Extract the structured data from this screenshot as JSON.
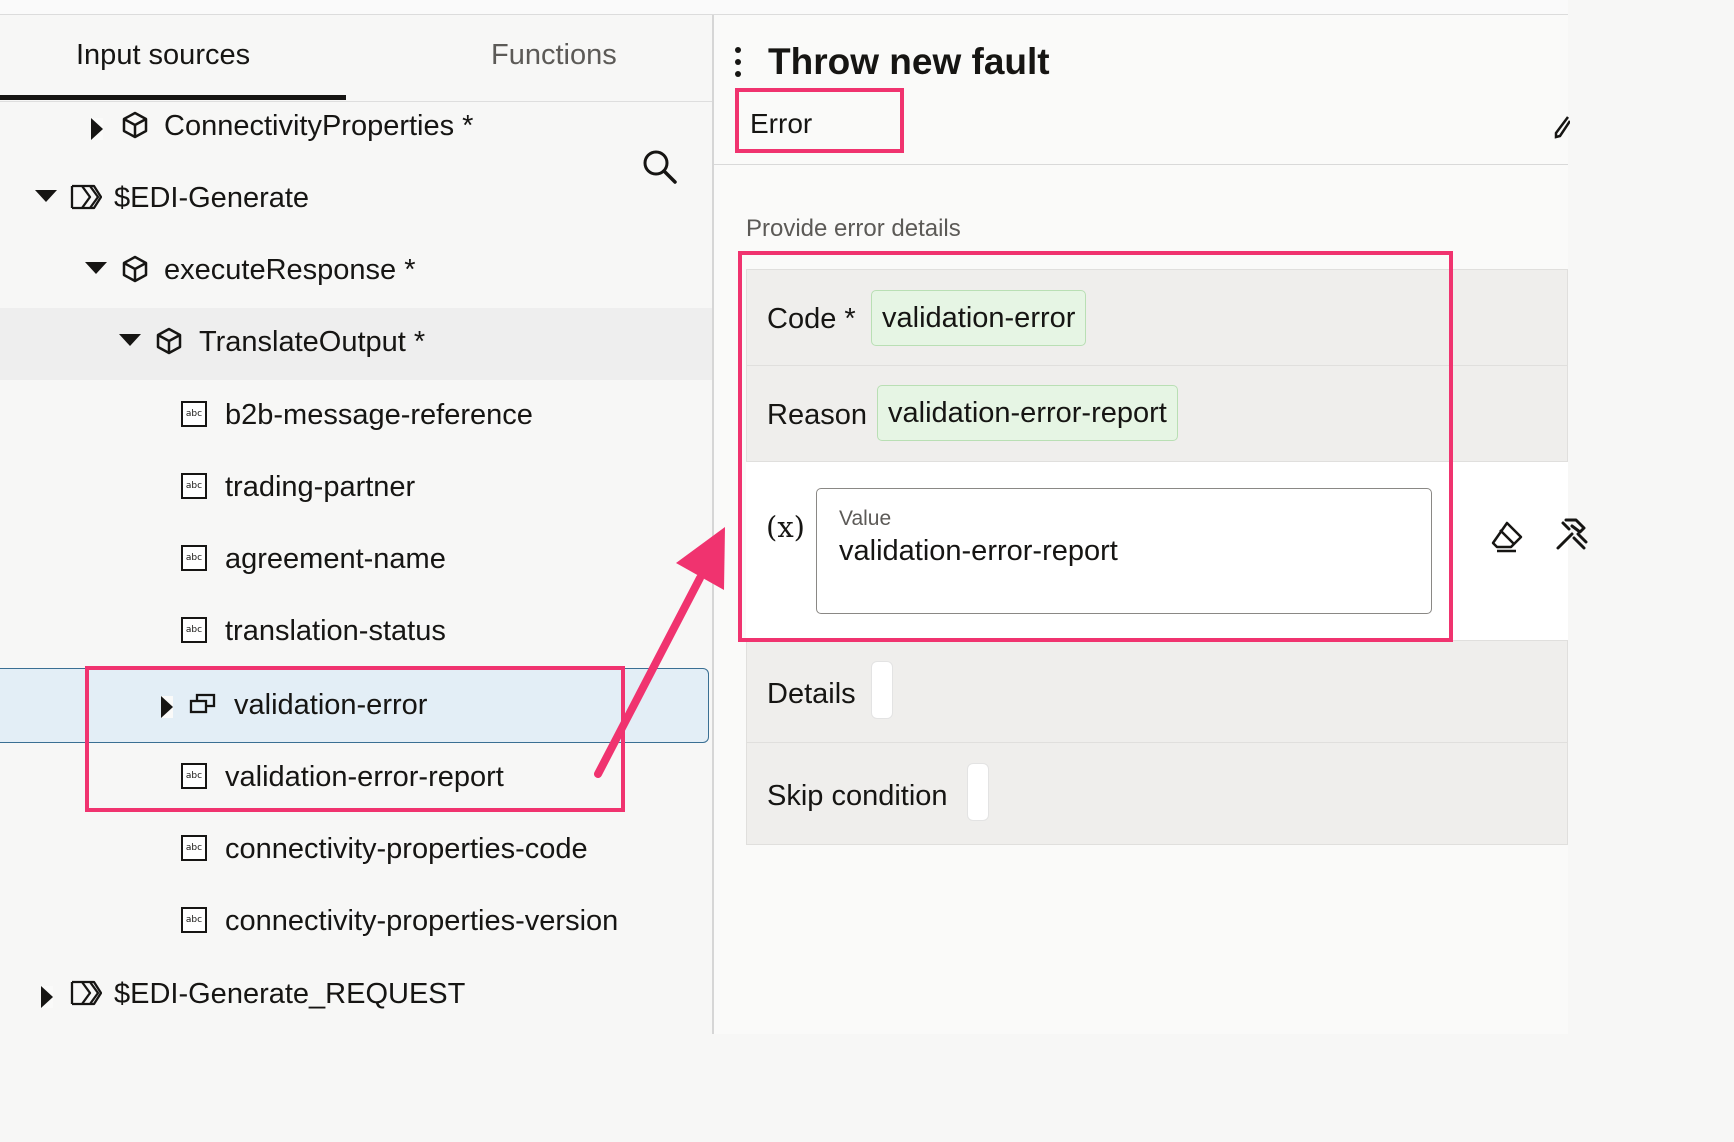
{
  "left_panel": {
    "tabs": [
      {
        "label": "Input sources",
        "active": true
      },
      {
        "label": "Functions",
        "active": false
      }
    ],
    "tree": [
      {
        "label": "ConnectivityProperties *",
        "icon": "object-icon",
        "expanded": false
      },
      {
        "label": "$EDI-Generate",
        "icon": "source-icon",
        "expanded": true
      },
      {
        "label": "executeResponse *",
        "icon": "object-icon",
        "expanded": true
      },
      {
        "label": "TranslateOutput *",
        "icon": "object-icon",
        "expanded": true
      },
      {
        "label": "b2b-message-reference",
        "icon": "string-icon"
      },
      {
        "label": "trading-partner",
        "icon": "string-icon"
      },
      {
        "label": "agreement-name",
        "icon": "string-icon"
      },
      {
        "label": "translation-status",
        "icon": "string-icon"
      },
      {
        "label": "validation-error",
        "icon": "collection-icon",
        "expanded": false,
        "selected": true
      },
      {
        "label": "validation-error-report",
        "icon": "string-icon"
      },
      {
        "label": "connectivity-properties-code",
        "icon": "string-icon"
      },
      {
        "label": "connectivity-properties-version",
        "icon": "string-icon"
      },
      {
        "label": "$EDI-Generate_REQUEST",
        "icon": "source-icon",
        "expanded": false
      }
    ]
  },
  "right_panel": {
    "title": "Throw new fault",
    "subtitle": "Error",
    "section_label": "Provide error details",
    "fields": {
      "code": {
        "label": "Code *",
        "value": "validation-error"
      },
      "reason": {
        "label": "Reason",
        "value": "validation-error-report"
      },
      "details": {
        "label": "Details"
      },
      "skip_condition": {
        "label": "Skip condition"
      }
    },
    "value_editor": {
      "prefix": "(x)",
      "label": "Value",
      "value": "validation-error-report"
    }
  },
  "colors": {
    "highlight": "#f0336f",
    "chip_bg": "#e6f5e4",
    "selected_row": "#e3eef6"
  }
}
